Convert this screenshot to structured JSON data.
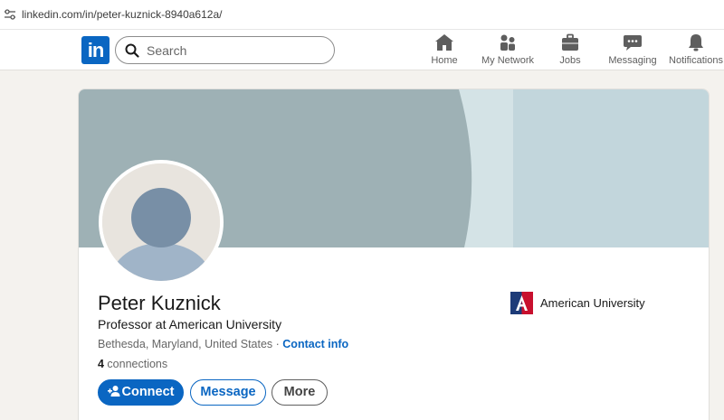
{
  "browser": {
    "url": "linkedin.com/in/peter-kuznick-8940a612a/"
  },
  "nav": {
    "logo_text": "in",
    "search_placeholder": "Search",
    "items": [
      {
        "label": "Home",
        "icon": "home-icon"
      },
      {
        "label": "My Network",
        "icon": "people-icon"
      },
      {
        "label": "Jobs",
        "icon": "briefcase-icon"
      },
      {
        "label": "Messaging",
        "icon": "chat-icon"
      },
      {
        "label": "Notifications",
        "icon": "bell-icon"
      }
    ]
  },
  "profile": {
    "name": "Peter Kuznick",
    "headline": "Professor at American University",
    "location": "Bethesda, Maryland, United States",
    "separator": " · ",
    "contact_label": "Contact info",
    "connections_count": "4",
    "connections_label": " connections",
    "organization": "American University"
  },
  "actions": {
    "connect": "Connect",
    "message": "Message",
    "more": "More"
  },
  "colors": {
    "brand_blue": "#0a66c2",
    "banner_dark": "#9eb1b5",
    "banner_light": "#c2d6dc",
    "university_red": "#c8102e",
    "university_blue": "#1d3b78"
  }
}
